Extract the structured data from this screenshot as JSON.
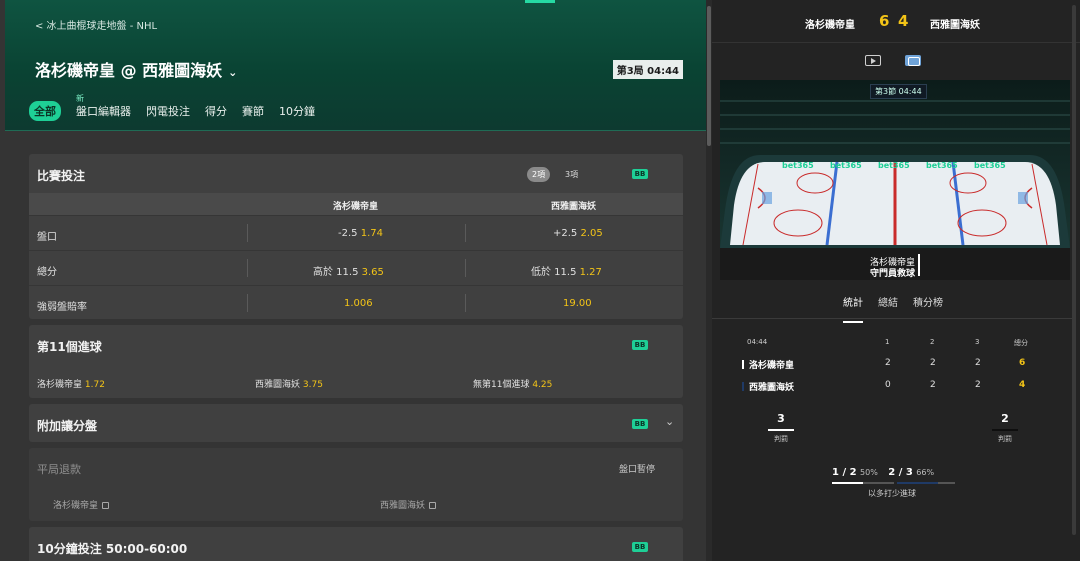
{
  "breadcrumb": "< 冰上曲棍球走地盤 - NHL",
  "match": {
    "title": "洛杉磯帝皇 @ 西雅圖海妖",
    "period_label": "第3局 04:44"
  },
  "tabs": [
    {
      "label": "全部",
      "active": true
    },
    {
      "label": "盤口編輯器",
      "new_badge": "新"
    },
    {
      "label": "閃電投注"
    },
    {
      "label": "得分"
    },
    {
      "label": "賽節"
    },
    {
      "label": "10分鐘"
    }
  ],
  "bb_badge": "BB",
  "market_main": {
    "title": "比賽投注",
    "toggle_2way": "2項",
    "toggle_3way": "3項",
    "col_home": "洛杉磯帝皇",
    "col_away": "西雅圖海妖",
    "rows": [
      {
        "label": "盤口",
        "home_line": "-2.5",
        "home_odds": "1.74",
        "away_line": "+2.5",
        "away_odds": "2.05"
      },
      {
        "label": "總分",
        "home_line": "高於 11.5",
        "home_odds": "3.65",
        "away_line": "低於 11.5",
        "away_odds": "1.27"
      },
      {
        "label": "強弱盤賠率",
        "home_line": "",
        "home_odds": "1.006",
        "away_line": "",
        "away_odds": "19.00"
      }
    ]
  },
  "market_11th": {
    "title": "第11個進球",
    "opts": [
      {
        "label": "洛杉磯帝皇",
        "odds": "1.72"
      },
      {
        "label": "西雅圖海妖",
        "odds": "3.75"
      },
      {
        "label": "無第11個進球",
        "odds": "4.25"
      }
    ]
  },
  "market_alt": {
    "title": "附加讓分盤"
  },
  "market_draw": {
    "title": "平局退款",
    "status": "盤口暫停",
    "home": "洛杉磯帝皇",
    "away": "西雅圖海妖"
  },
  "market_10min": {
    "title": "10分鐘投注 50:00-60:00"
  },
  "score": {
    "home_team": "洛杉磯帝皇",
    "away_team": "西雅圖海妖",
    "home_score": "6",
    "away_score": "4"
  },
  "arena": {
    "clock": "第3節 04:44",
    "caption_team": "洛杉磯帝皇",
    "caption_event": "守門員救球",
    "board_text": "bet365"
  },
  "stats_tabs": [
    "統計",
    "總結",
    "積分榜"
  ],
  "stats": {
    "time": "04:44",
    "headers": [
      "1",
      "2",
      "3",
      "總分"
    ],
    "teams": [
      {
        "name": "洛杉磯帝皇",
        "p": [
          "2",
          "2",
          "2"
        ],
        "total": "6",
        "color": "#ffffff"
      },
      {
        "name": "西雅圖海妖",
        "p": [
          "0",
          "2",
          "2"
        ],
        "total": "4",
        "color": "#1f3a66"
      }
    ],
    "penalties": {
      "home": "3",
      "away": "2",
      "label": "判罰"
    },
    "powerplay": {
      "home": "1 / 2",
      "home_pct": "50%",
      "away": "2 / 3",
      "away_pct": "66%",
      "label": "以多打少進球"
    }
  },
  "colors": {
    "accent": "#1ecf96",
    "odds": "#f3c417",
    "hero": "#0f5441"
  }
}
